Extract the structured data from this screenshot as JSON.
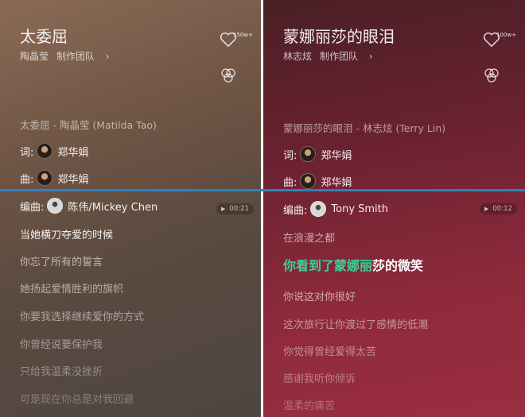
{
  "left": {
    "title": "太委屈",
    "artist": "陶晶莹",
    "team": "制作团队",
    "like_count": "150w+",
    "song_source": "太委屈 - 陶晶莹 (Matilda Tao)",
    "credits": [
      {
        "label": "词:",
        "name": "郑华娟"
      },
      {
        "label": "曲:",
        "name": "郑华娟"
      },
      {
        "label": "编曲:",
        "name": "陈伟/Mickey Chen"
      }
    ],
    "timer": "00:21",
    "lyrics": [
      "当她横刀夺爱的时候",
      "你忘了所有的誓言",
      "她扬起爱情胜利的旗帜",
      "你要我选择继续爱你的方式",
      "你曾经说要保护我",
      "只给我温柔没挫折",
      "可是现在你总是对我回避"
    ]
  },
  "right": {
    "title": "蒙娜丽莎的眼泪",
    "artist": "林志炫",
    "team": "制作团队",
    "like_count": "100w+",
    "song_source": "蒙娜丽莎的眼泪 - 林志炫 (Terry Lin)",
    "credits": [
      {
        "label": "词:",
        "name": "郑华娟"
      },
      {
        "label": "曲:",
        "name": "郑华娟"
      },
      {
        "label": "编曲:",
        "name": "Tony Smith"
      }
    ],
    "timer": "00:12",
    "lyric_before": "在浪漫之都",
    "current_done": "你看到了蒙娜丽",
    "current_rest": "莎的微笑",
    "lyrics_after": [
      "你说这对你很好",
      "这次旅行让你渡过了感情的低潮",
      "你觉得曾经爱得太苦",
      "感谢我听你倾诉",
      "温柔的痛苦"
    ]
  },
  "colors": {
    "highlight": "#3ecf9b",
    "divider": "#2f7fc0"
  }
}
